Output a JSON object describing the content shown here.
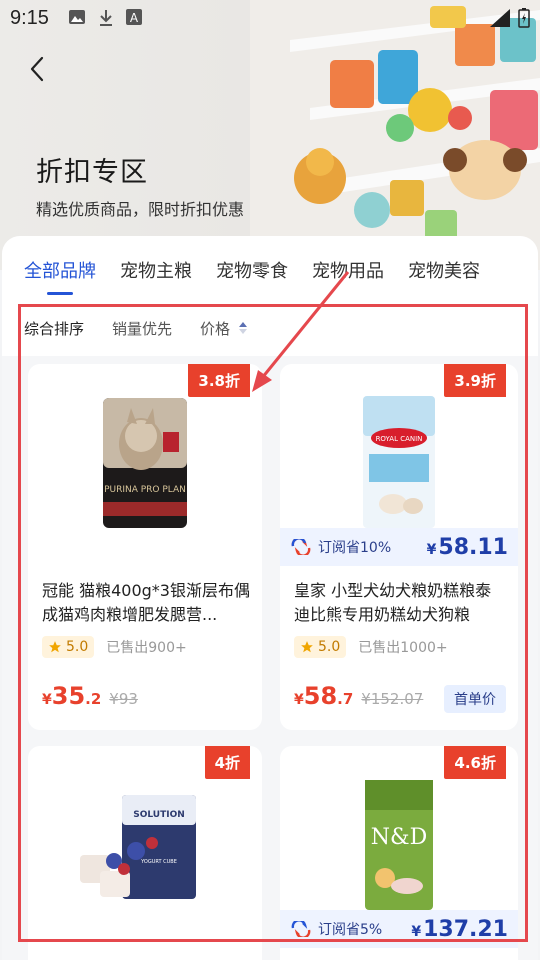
{
  "status": {
    "time": "9:15"
  },
  "header": {
    "title": "折扣专区",
    "subtitle": "精选优质商品，限时折扣优惠"
  },
  "tabs": [
    {
      "label": "全部品牌",
      "active": true
    },
    {
      "label": "宠物主粮",
      "active": false
    },
    {
      "label": "宠物零食",
      "active": false
    },
    {
      "label": "宠物用品",
      "active": false
    },
    {
      "label": "宠物美容",
      "active": false
    }
  ],
  "sort": {
    "comprehensive": "综合排序",
    "sales": "销量优先",
    "price": "价格"
  },
  "products": [
    {
      "discount": "3.8折",
      "image_label": "PURINA PRO PLAN",
      "name": "冠能 猫粮400g*3银渐层布偶成猫鸡肉粮增肥发腮营...",
      "rating": "5.0",
      "sold": "已售出900+",
      "price_currency": "¥",
      "price_int": "35",
      "price_dec": ".2",
      "old_price": "¥93"
    },
    {
      "discount": "3.9折",
      "image_label": "ROYAL CANIN",
      "subscription": {
        "label": "订阅省10%",
        "currency": "¥",
        "price": "58.11"
      },
      "name": "皇家 小型犬幼犬粮奶糕粮泰迪比熊专用奶糕幼犬狗粮",
      "rating": "5.0",
      "sold": "已售出1000+",
      "price_currency": "¥",
      "price_int": "58",
      "price_dec": ".7",
      "old_price": "¥152.07",
      "tag": "首单价"
    },
    {
      "discount": "4折",
      "image_label": "SOLUTION",
      "image_sublabel": "YOGURT CUBE"
    },
    {
      "discount": "4.6折",
      "image_label": "N&D",
      "subscription": {
        "label": "订阅省5%",
        "currency": "¥",
        "price": "137.21"
      }
    }
  ],
  "colors": {
    "accent": "#2454d6",
    "discount": "#e8412c",
    "highlight": "#e5484d"
  }
}
